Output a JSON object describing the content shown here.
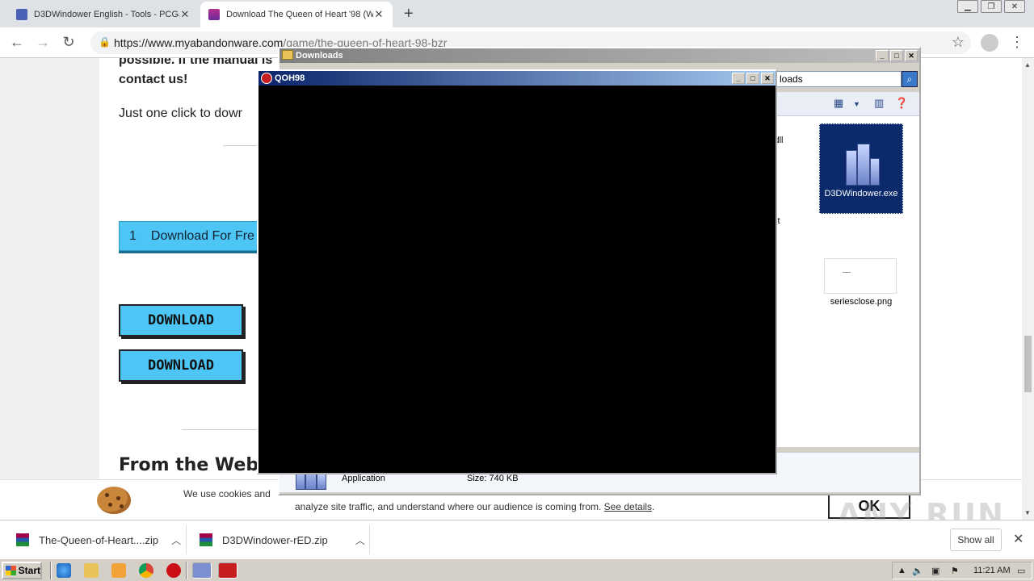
{
  "browser": {
    "tabs": [
      {
        "title": "D3DWindower English - Tools - PCGa",
        "active": false
      },
      {
        "title": "Download The Queen of Heart '98 (W",
        "active": true
      }
    ],
    "new_tab": "+",
    "url_host": "https://www.myabandonware.com",
    "url_path": "/game/the-queen-of-heart-98-bzr"
  },
  "page": {
    "line1": "possible. If the manual is",
    "line2": "contact us!",
    "line3": "Just one click to dowr",
    "download_free": {
      "num": "1",
      "label": "Download For Fre"
    },
    "download_btn_1": "DOWNLOAD",
    "download_btn_2": "DOWNLOAD",
    "from_the_web": "From the Web",
    "cookie_text_1": "We use cookies and",
    "cookie_text_2": "analyze site traffic, and understand where our audience is coming from.",
    "cookie_link": "See details",
    "cookie_ok": "OK"
  },
  "explorer": {
    "title": "Downloads",
    "search_value": "loads",
    "files": [
      {
        "name": "D3DWindower.exe",
        "selected": true
      },
      {
        "name": "seriesclose.png",
        "selected": false
      },
      {
        "name": "dll",
        "selected": false
      },
      {
        "name": "t",
        "selected": false
      }
    ],
    "details": {
      "type": "Application",
      "size": "Size: 740 KB"
    }
  },
  "game": {
    "title": "QOH98"
  },
  "downloads_bar": {
    "items": [
      {
        "name": "The-Queen-of-Heart....zip"
      },
      {
        "name": "D3DWindower-rED.zip"
      }
    ],
    "show_all": "Show all"
  },
  "taskbar": {
    "start": "Start",
    "clock": "11:21 AM"
  },
  "watermark": "ANY RUN"
}
